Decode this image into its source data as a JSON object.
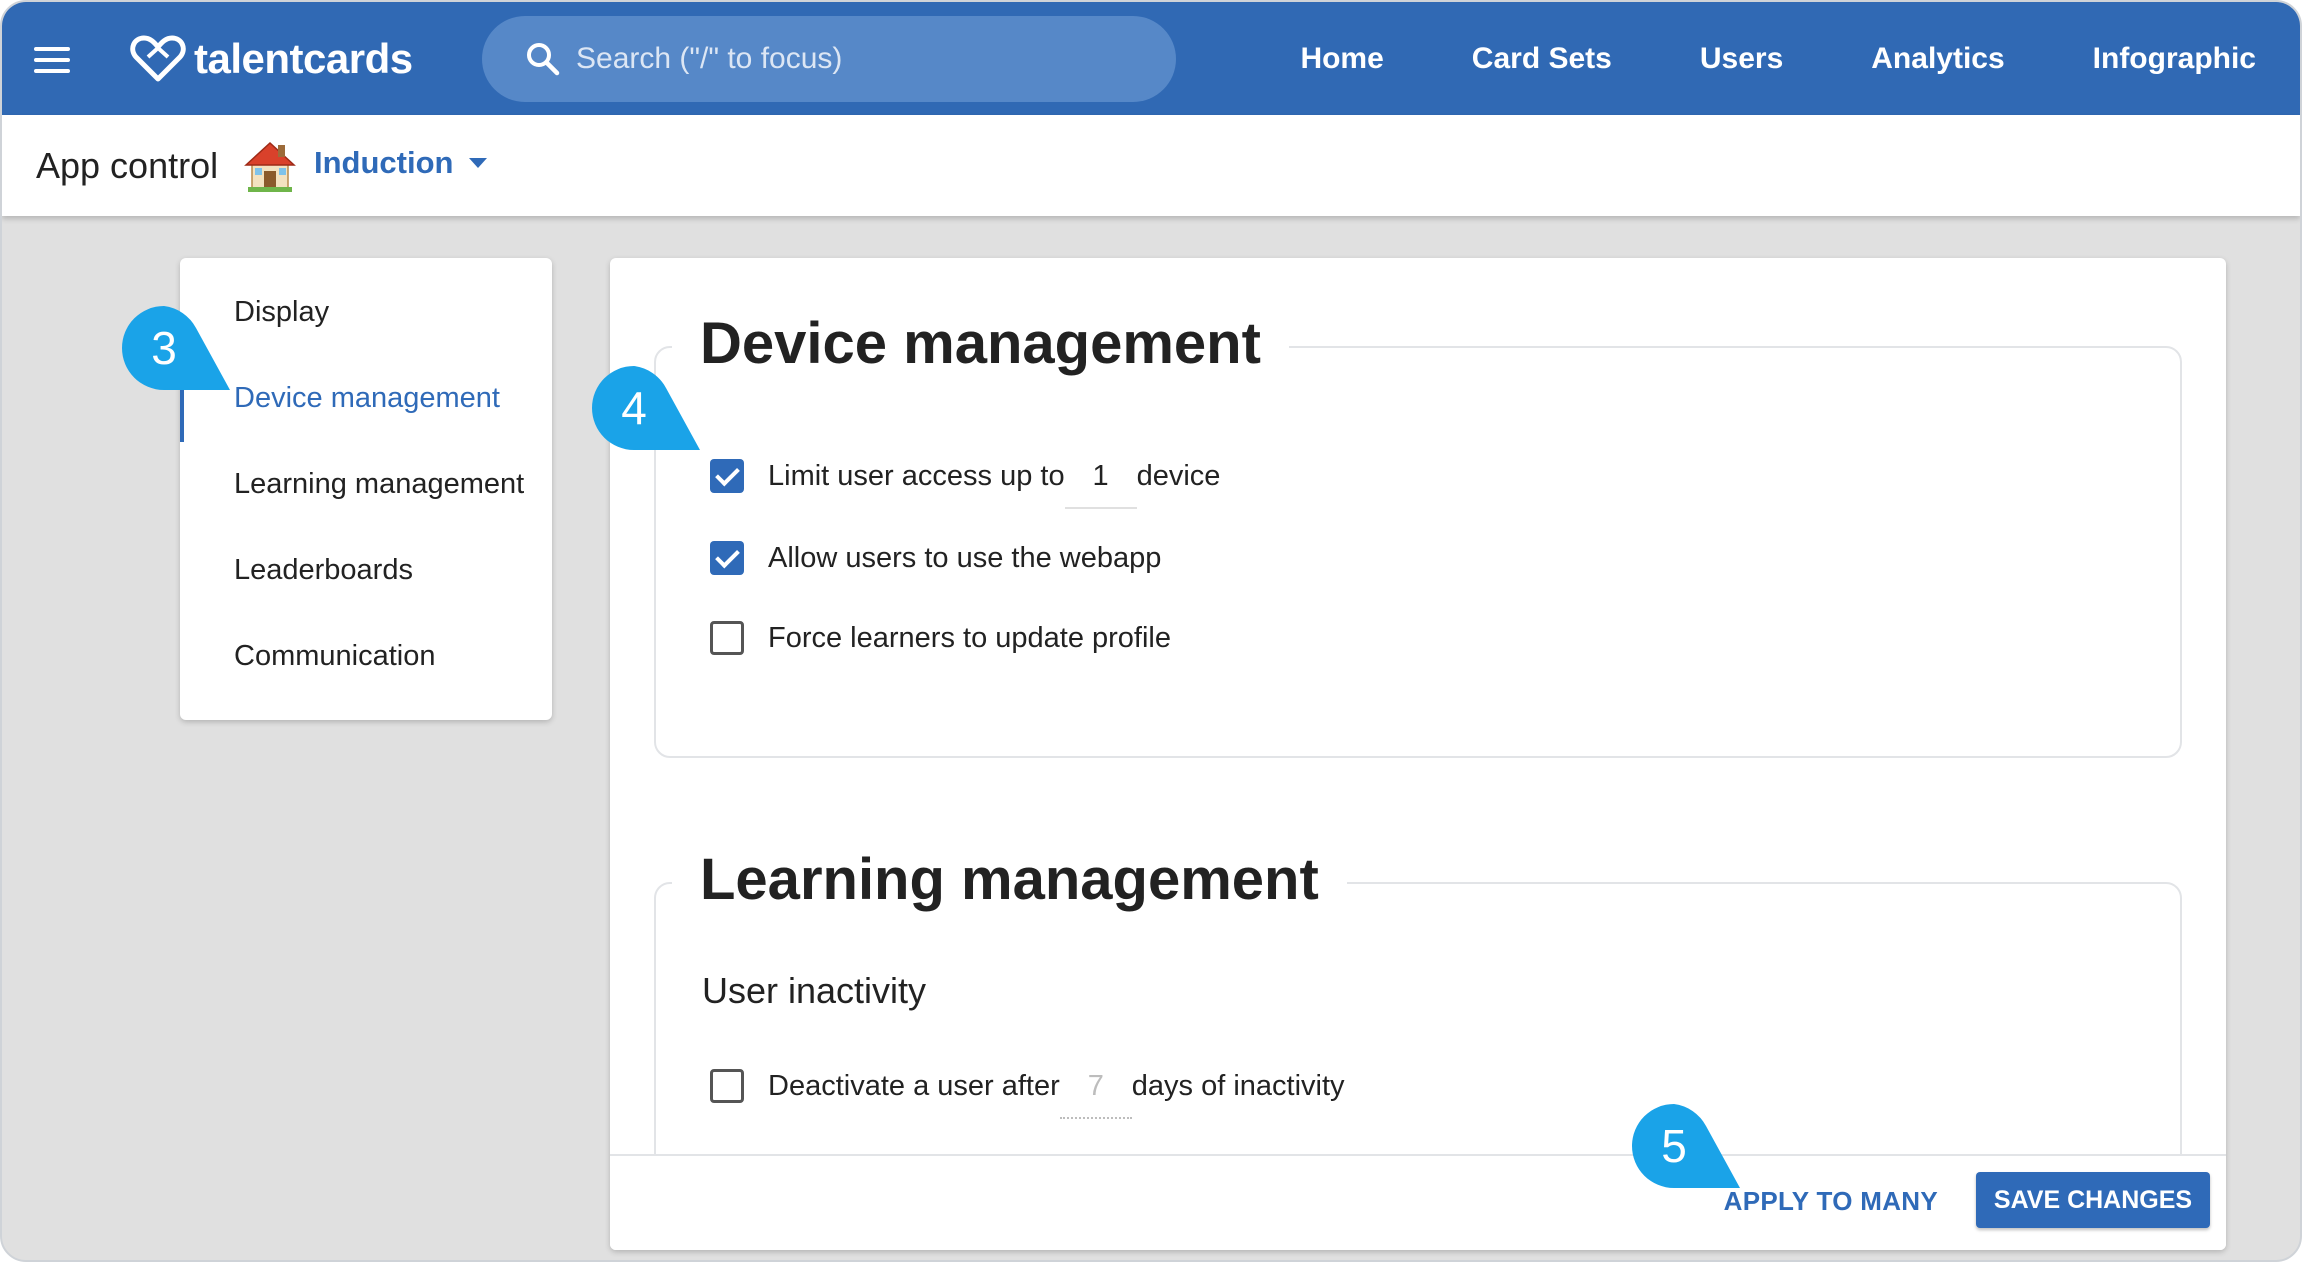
{
  "topbar": {
    "brand": "talentcards",
    "search_placeholder": "Search (\"/\" to focus)",
    "nav": [
      "Home",
      "Card Sets",
      "Users",
      "Analytics",
      "Infographic"
    ]
  },
  "subbar": {
    "title": "App control",
    "app_name": "Induction"
  },
  "sidenav": {
    "items": [
      "Display",
      "Device management",
      "Learning management",
      "Leaderboards",
      "Communication"
    ],
    "active": "Device management"
  },
  "device_management": {
    "title": "Device management",
    "limit_label_pre": "Limit user access up to",
    "limit_value": "1",
    "limit_label_post": "device",
    "limit_checked": true,
    "webapp_label": "Allow users to use the webapp",
    "webapp_checked": true,
    "force_label": "Force learners to update profile",
    "force_checked": false
  },
  "learning_management": {
    "title": "Learning management",
    "subtitle": "User inactivity",
    "deactivate_pre": "Deactivate a user after",
    "deactivate_value": "7",
    "deactivate_post": "days of inactivity",
    "deactivate_checked": false
  },
  "footer": {
    "apply_label": "APPLY TO MANY",
    "save_label": "SAVE CHANGES"
  },
  "callouts": [
    "3",
    "4",
    "5"
  ],
  "colors": {
    "brand_blue": "#3069b4",
    "callout_blue": "#1aa3e8"
  }
}
